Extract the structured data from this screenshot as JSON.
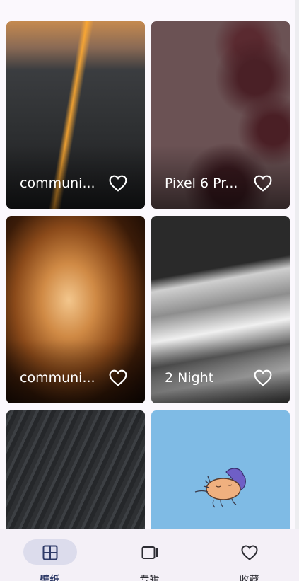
{
  "wallpapers": [
    {
      "title": "communi...",
      "art": "fall"
    },
    {
      "title": "Pixel 6 Pr...",
      "art": "flower"
    },
    {
      "title": "communi...",
      "art": "rose"
    },
    {
      "title": "2 Night",
      "art": "dunes"
    },
    {
      "title": "",
      "art": "feather"
    },
    {
      "title": "",
      "art": "sleep"
    }
  ],
  "nav": {
    "items": [
      {
        "label": "壁纸",
        "icon": "grid-icon",
        "active": true
      },
      {
        "label": "专辑",
        "icon": "album-icon",
        "active": false
      },
      {
        "label": "收藏",
        "icon": "heart-icon",
        "active": false
      }
    ]
  },
  "colors": {
    "background": "#fbf8fd",
    "nav_background": "#f4f0f7",
    "active_pill": "#dcdcec",
    "active_label": "#2e3a68"
  }
}
